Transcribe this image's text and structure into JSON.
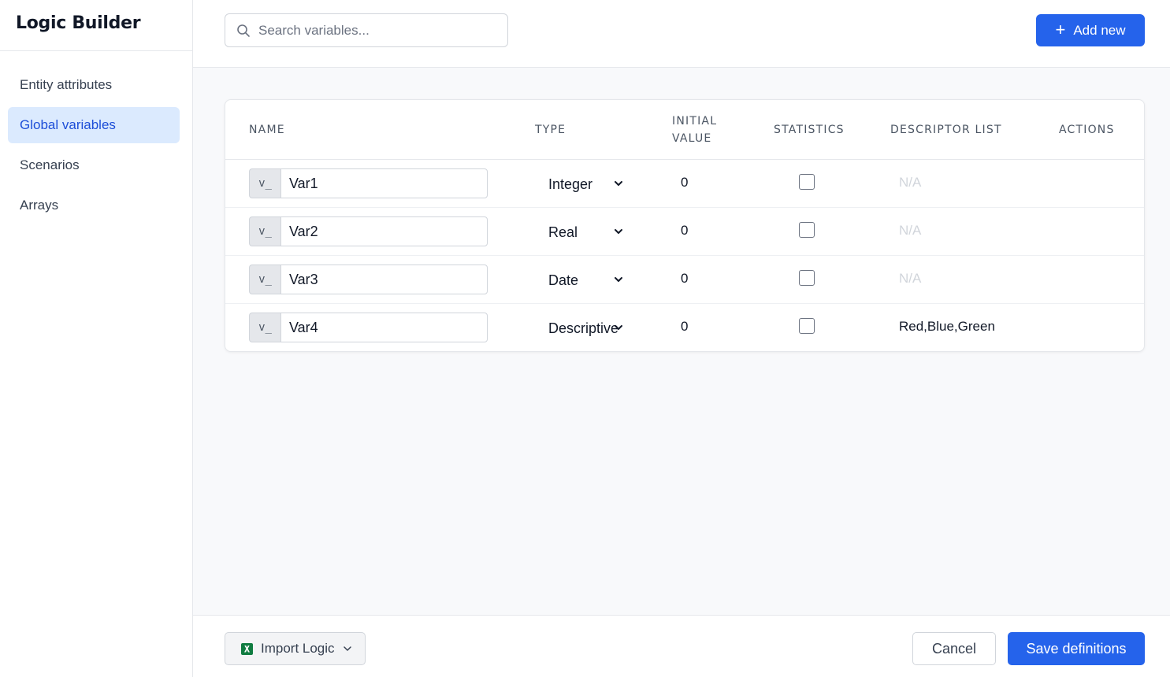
{
  "app": {
    "title": "Logic Builder"
  },
  "sidebar": {
    "items": [
      {
        "label": "Entity attributes",
        "active": false
      },
      {
        "label": "Global variables",
        "active": true
      },
      {
        "label": "Scenarios",
        "active": false
      },
      {
        "label": "Arrays",
        "active": false
      }
    ]
  },
  "search": {
    "placeholder": "Search variables...",
    "value": "",
    "icon": "search-icon"
  },
  "toolbar": {
    "add_label": "Add new",
    "add_icon": "+"
  },
  "table": {
    "columns": [
      "NAME",
      "TYPE",
      "INITIAL VALUE",
      "STATISTICS",
      "DESCRIPTOR LIST",
      "ACTIONS"
    ],
    "initial_value_lines": [
      "INITIAL",
      "VALUE"
    ],
    "prefix": "v_",
    "rows": [
      {
        "name": "Var1",
        "type": "Integer",
        "initial": "0",
        "statistics": false,
        "descriptor": "N/A"
      },
      {
        "name": "Var2",
        "type": "Real",
        "initial": "0",
        "statistics": false,
        "descriptor": "N/A"
      },
      {
        "name": "Var3",
        "type": "Date",
        "initial": "0",
        "statistics": false,
        "descriptor": "N/A"
      },
      {
        "name": "Var4",
        "type": "Descriptive",
        "initial": "0",
        "statistics": false,
        "descriptor": "Red,Blue,Green"
      }
    ]
  },
  "footer": {
    "import_label": "Import Logic",
    "cancel_label": "Cancel",
    "save_label": "Save definitions"
  },
  "colors": {
    "primary": "#2563eb",
    "active_nav_bg": "#dbeafe",
    "excel_green": "#107c41"
  }
}
